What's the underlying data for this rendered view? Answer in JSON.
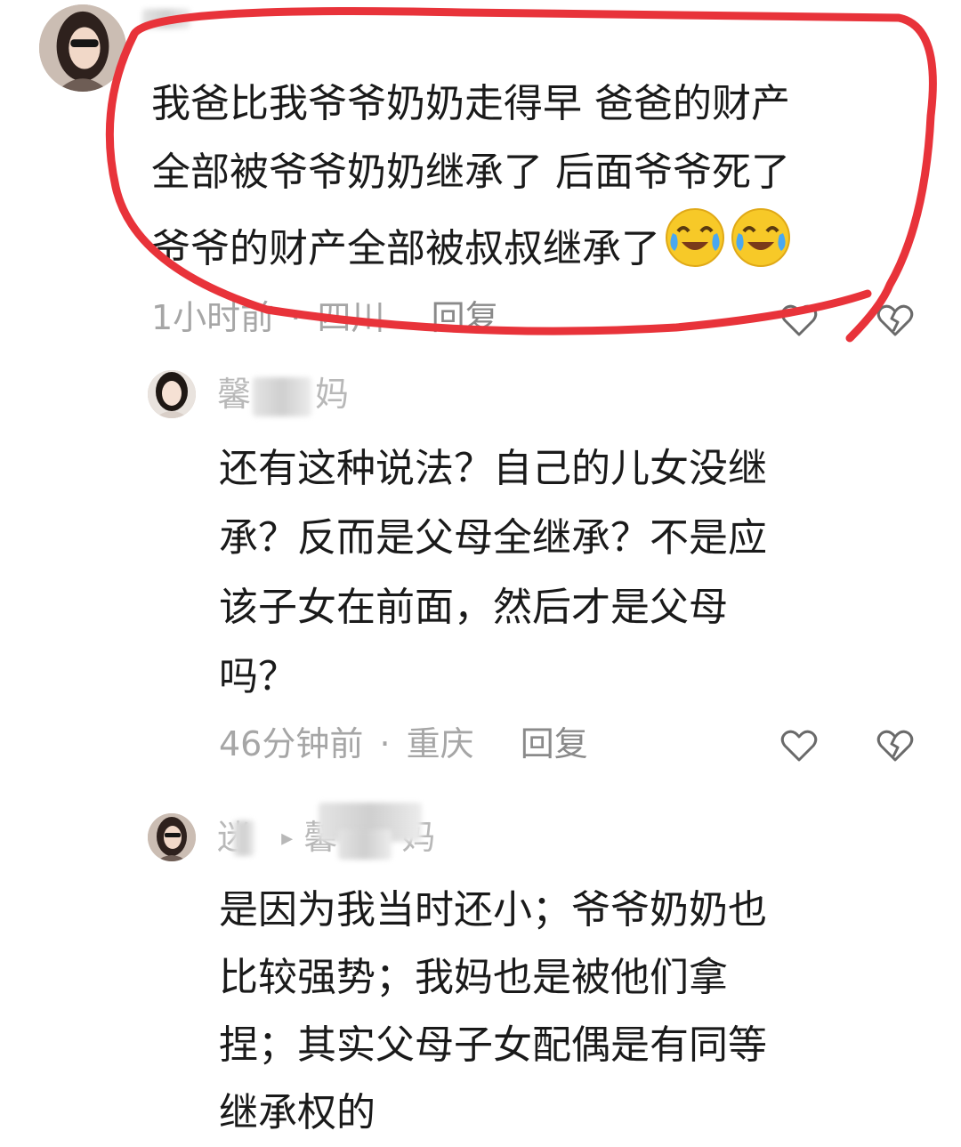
{
  "comments": [
    {
      "text_lines": [
        "我爸比我爷爷奶奶走得早 爸爸的财产",
        "全部被爷爷奶奶继承了 后面爷爷死了",
        "爷爷的财产全部被叔叔继承了"
      ],
      "emoji": [
        "crying-laughing-emoji",
        "crying-laughing-emoji"
      ],
      "time": "1小时前",
      "location": "四川",
      "reply_label": "回复"
    },
    {
      "username": "馨",
      "username_tail": "妈",
      "text_lines": [
        "还有这种说法？自己的儿女没继",
        "承？反而是父母全继承？不是应",
        "该子女在前面，然后才是父母",
        "吗？"
      ],
      "time": "46分钟前",
      "location": "重庆",
      "reply_label": "回复"
    },
    {
      "username": "迷",
      "reply_arrow": "▸",
      "reply_to": "馨",
      "reply_to_tail": "妈",
      "text_lines": [
        "是因为我当时还小；爷爷奶奶也",
        "比较强势；我妈也是被他们拿",
        "捏；其实父母子女配偶是有同等",
        "继承权的"
      ]
    }
  ],
  "separator": "·",
  "colors": {
    "highlight_red": "#e8333a",
    "meta_gray": "#a6a6a6",
    "text": "#1a1a1a"
  }
}
